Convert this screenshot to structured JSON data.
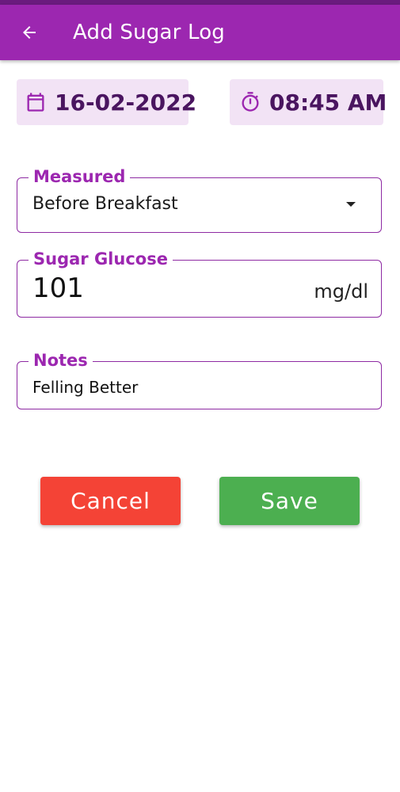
{
  "app_bar": {
    "title": "Add Sugar Log",
    "back_icon": "arrow-left-icon",
    "background": "#9c27b0"
  },
  "date_time": {
    "date": "16-02-2022",
    "date_icon": "calendar-icon",
    "time": "08:45 AM",
    "time_icon": "stopwatch-icon"
  },
  "form": {
    "measured": {
      "label": "Measured",
      "value": "Before Breakfast"
    },
    "sugar": {
      "label": "Sugar Glucose",
      "value": "101",
      "unit": "mg/dl"
    },
    "notes": {
      "label": "Notes",
      "value": "Felling Better"
    }
  },
  "actions": {
    "cancel_label": "Cancel",
    "cancel_color": "#f44336",
    "save_label": "Save",
    "save_color": "#4caf50"
  },
  "colors": {
    "accent": "#9c27b0",
    "chip_bg": "#f2e3f5",
    "chip_text": "#4a1560"
  }
}
